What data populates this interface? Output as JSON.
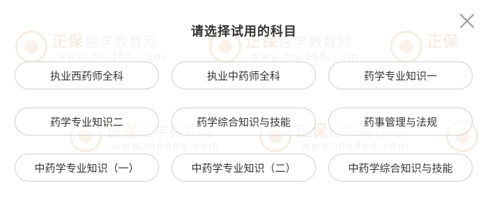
{
  "dialog": {
    "title": "请选择试用的科目",
    "close_icon": "close-icon"
  },
  "watermark": {
    "brand": "正保",
    "subtitle": "医学教育网",
    "url": "www.med66.com"
  },
  "subjects": [
    {
      "label": "执业西药师全科"
    },
    {
      "label": "执业中药师全科"
    },
    {
      "label": "药学专业知识一"
    },
    {
      "label": "药学专业知识二"
    },
    {
      "label": "药学综合知识与技能"
    },
    {
      "label": "药事管理与法规"
    },
    {
      "label": "中药学专业知识（一）"
    },
    {
      "label": "中药学专业知识（二）"
    },
    {
      "label": "中药学综合知识与技能"
    }
  ],
  "colors": {
    "text": "#333333",
    "border": "#cfcfcf",
    "close_icon": "#9a9a9a",
    "watermark": "#f3dcc6"
  }
}
